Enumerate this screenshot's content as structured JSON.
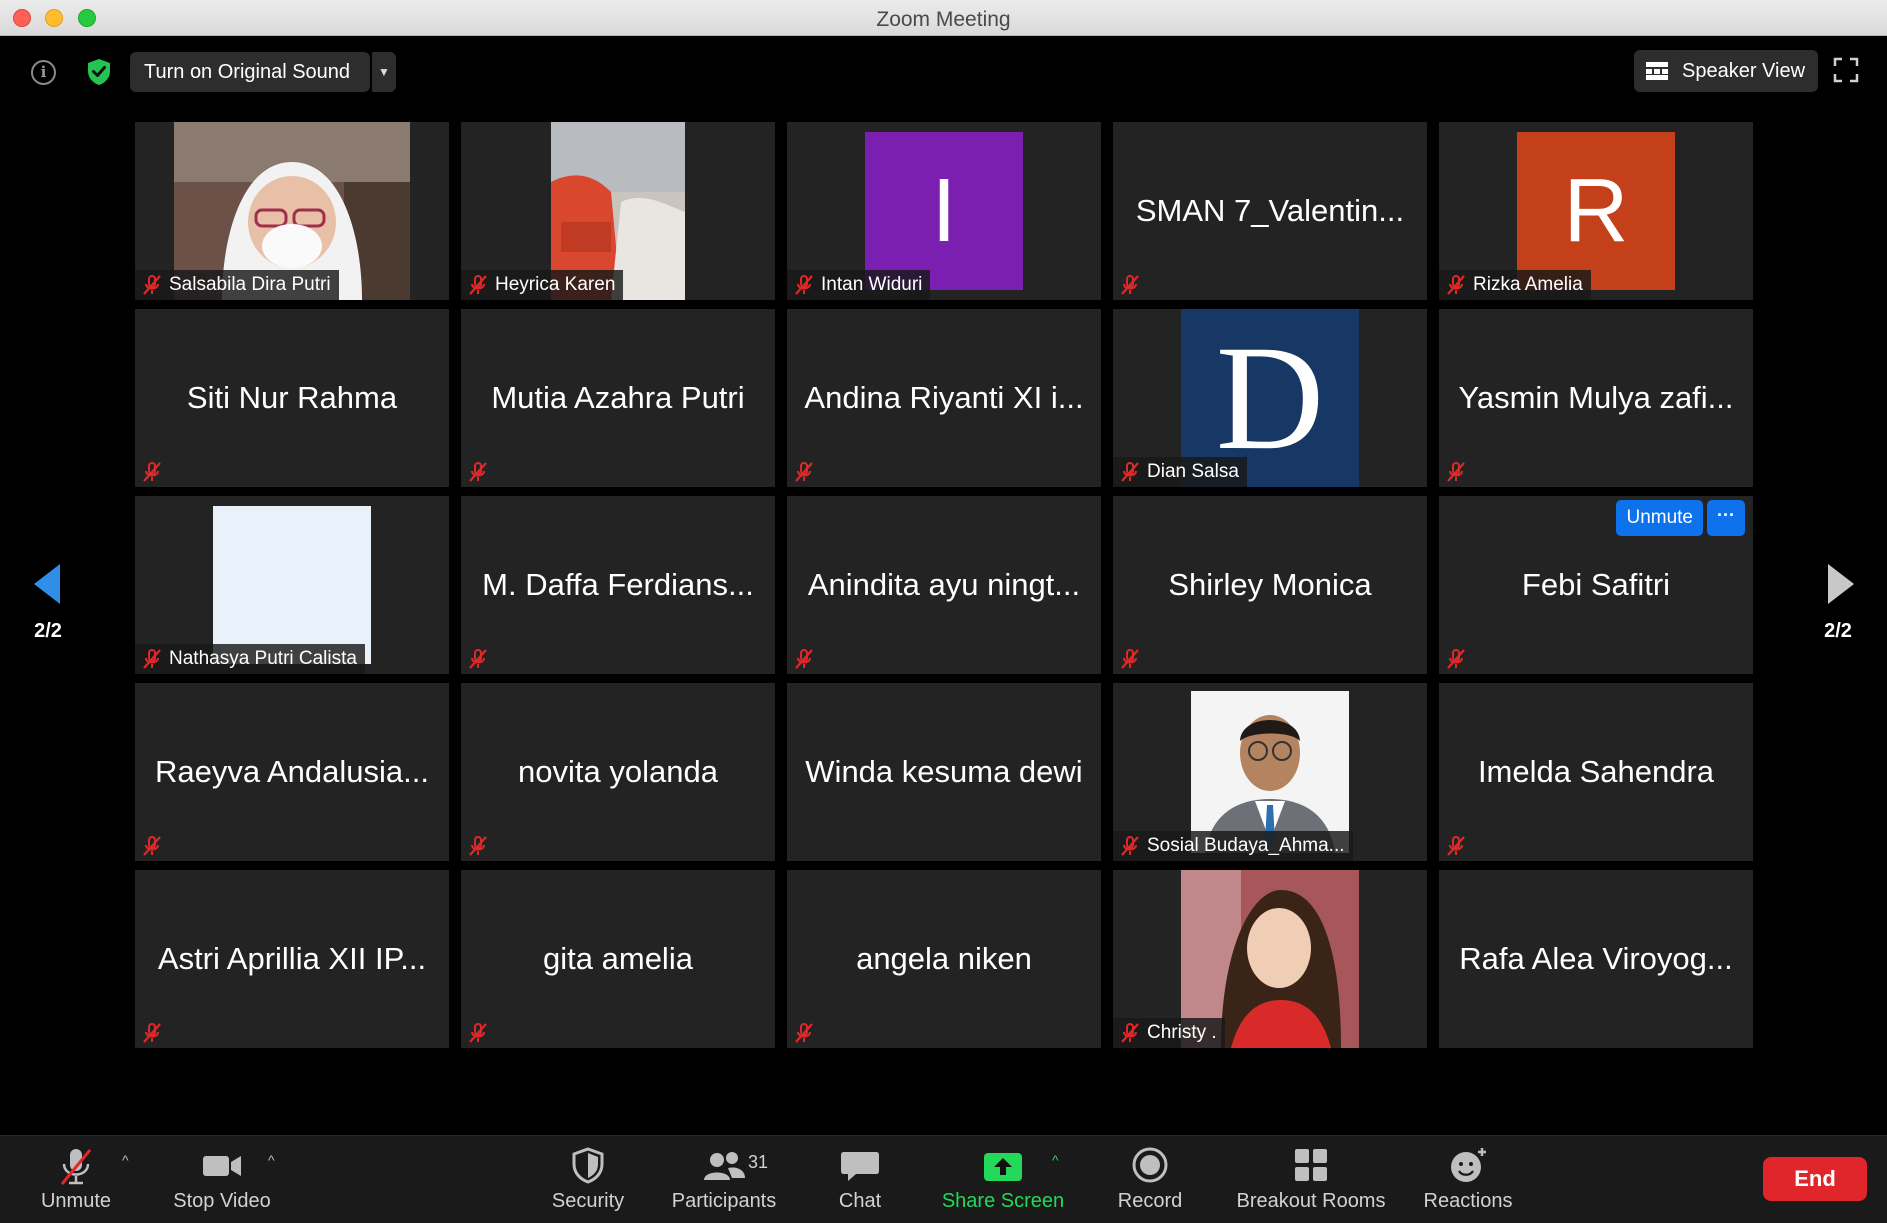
{
  "window": {
    "title": "Zoom Meeting"
  },
  "topbar": {
    "original_sound_label": "Turn on Original Sound",
    "view_label": "Speaker View"
  },
  "colors": {
    "accent": "#0e72ed",
    "end": "#e0262b",
    "share_green": "#23d959",
    "mute_red": "#e02828"
  },
  "pagination": {
    "left": "2/2",
    "right": "2/2"
  },
  "participants": [
    {
      "name": "Salsabila Dira Putri",
      "display": "photo",
      "muted": true
    },
    {
      "name": "Heyrica Karen",
      "display": "photo",
      "muted": true
    },
    {
      "name": "Intan Widuri",
      "display": "avatar",
      "initial": "I",
      "avatar_color": "#7a1fb0",
      "muted": true
    },
    {
      "name": "SMAN 7_Valentin...",
      "display": "name",
      "muted": true
    },
    {
      "name": "Rizka Amelia",
      "display": "avatar",
      "initial": "R",
      "avatar_color": "#c4401b",
      "muted": true
    },
    {
      "name": "Siti Nur Rahma",
      "display": "name",
      "muted": true
    },
    {
      "name": "Mutia Azahra Putri",
      "display": "name",
      "muted": true
    },
    {
      "name": "Andina Riyanti XI i...",
      "display": "name",
      "muted": true
    },
    {
      "name": "Dian Salsa",
      "display": "avatar",
      "initial": "D",
      "avatar_color": "#173865",
      "muted": true
    },
    {
      "name": "Yasmin Mulya zafi...",
      "display": "name",
      "muted": true
    },
    {
      "name": "Nathasya Putri Calista",
      "display": "blank",
      "muted": true
    },
    {
      "name": "M. Daffa Ferdians...",
      "display": "name",
      "muted": true
    },
    {
      "name": "Anindita ayu ningt...",
      "display": "name",
      "muted": true
    },
    {
      "name": "Shirley Monica",
      "display": "name",
      "muted": true
    },
    {
      "name": "Febi Safitri",
      "display": "name",
      "muted": true,
      "hover_actions": {
        "unmute": "Unmute",
        "more": "···"
      }
    },
    {
      "name": "Raeyva Andalusia...",
      "display": "name",
      "muted": true
    },
    {
      "name": "novita yolanda",
      "display": "name",
      "muted": true
    },
    {
      "name": "Winda kesuma dewi",
      "display": "name",
      "muted": false
    },
    {
      "name": "Sosial Budaya_Ahma...",
      "display": "photo",
      "muted": true
    },
    {
      "name": "Imelda Sahendra",
      "display": "name",
      "muted": true
    },
    {
      "name": "Astri Aprillia XII IP...",
      "display": "name",
      "muted": true
    },
    {
      "name": "gita amelia",
      "display": "name",
      "muted": true
    },
    {
      "name": "angela niken",
      "display": "name",
      "muted": true
    },
    {
      "name": "Christy .",
      "display": "photo",
      "muted": true
    },
    {
      "name": "Rafa Alea Viroyog...",
      "display": "name",
      "muted": false
    }
  ],
  "toolbar": {
    "unmute": "Unmute",
    "stop_video": "Stop Video",
    "security": "Security",
    "participants": "Participants",
    "participants_count": "31",
    "chat": "Chat",
    "share_screen": "Share Screen",
    "record": "Record",
    "breakout_rooms": "Breakout Rooms",
    "reactions": "Reactions",
    "end": "End"
  }
}
